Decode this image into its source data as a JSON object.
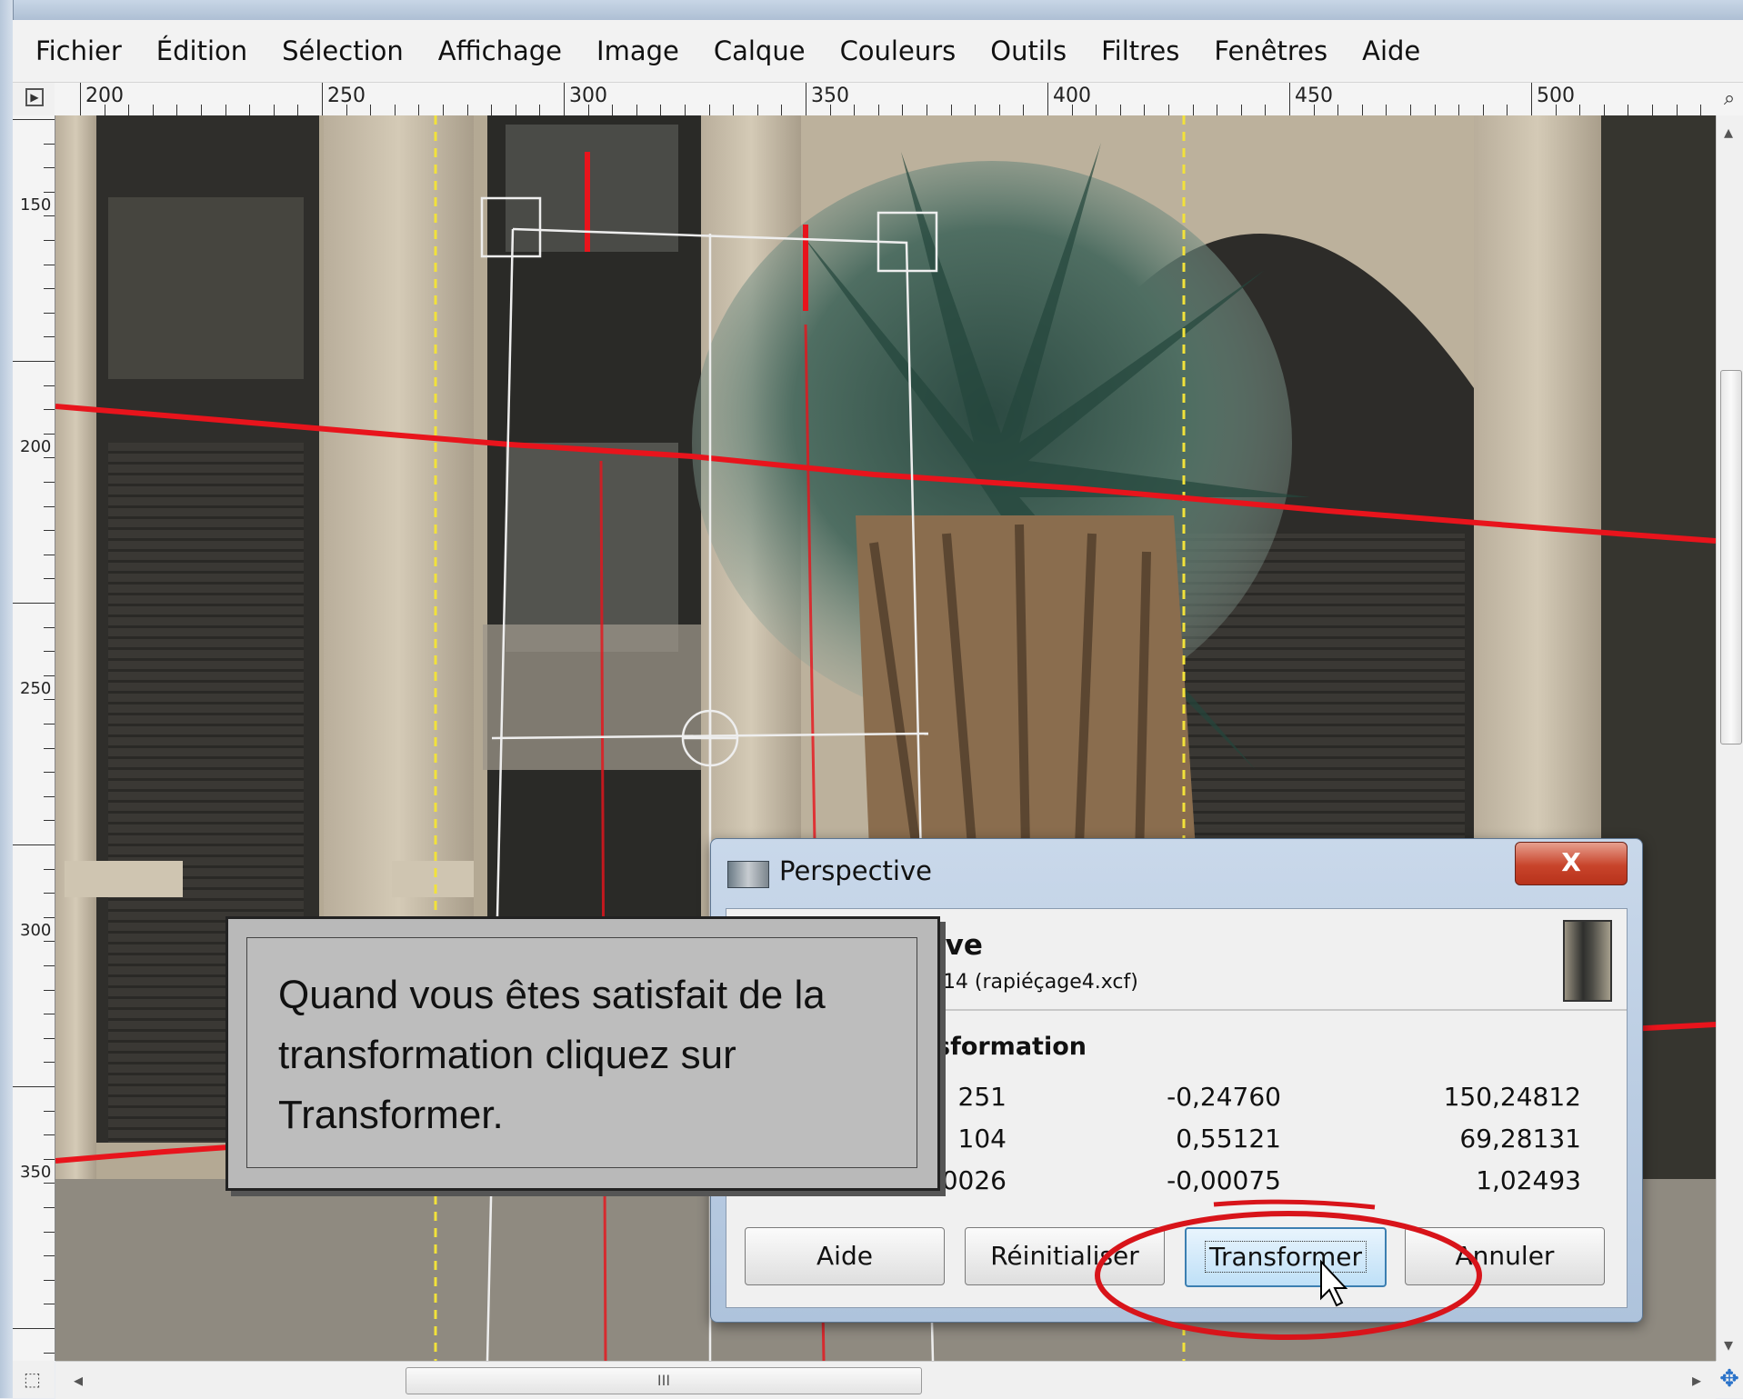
{
  "menubar": {
    "items": [
      "Fichier",
      "Édition",
      "Sélection",
      "Affichage",
      "Image",
      "Calque",
      "Couleurs",
      "Outils",
      "Filtres",
      "Fenêtres",
      "Aide"
    ]
  },
  "rulers": {
    "horizontal": [
      "200",
      "250",
      "300",
      "350",
      "400",
      "450",
      "500"
    ],
    "vertical": [
      "150",
      "200",
      "250",
      "300",
      "350"
    ]
  },
  "dialog": {
    "title": "Perspective",
    "close_label": "X",
    "header_name": "ive",
    "header_sub": "-14 (rapiéçage4.xcf)",
    "section": "sformation",
    "matrix": [
      [
        "251",
        "-0,24760",
        "150,24812"
      ],
      [
        "104",
        "0,55121",
        "69,28131"
      ],
      [
        "0026",
        "-0,00075",
        "1,02493"
      ]
    ],
    "buttons": {
      "help": "Aide",
      "reset": "Réinitialiser",
      "transform": "Transformer",
      "cancel": "Annuler"
    }
  },
  "callout": {
    "text": "Quand vous êtes satisfait de la transformation cliquez sur Transformer."
  },
  "scrollbar": {
    "thumb_grip": "III"
  },
  "colors": {
    "guide_red": "#e8141c",
    "annotation_red": "#d8141a",
    "dialog_frame": "#aec3dc"
  }
}
